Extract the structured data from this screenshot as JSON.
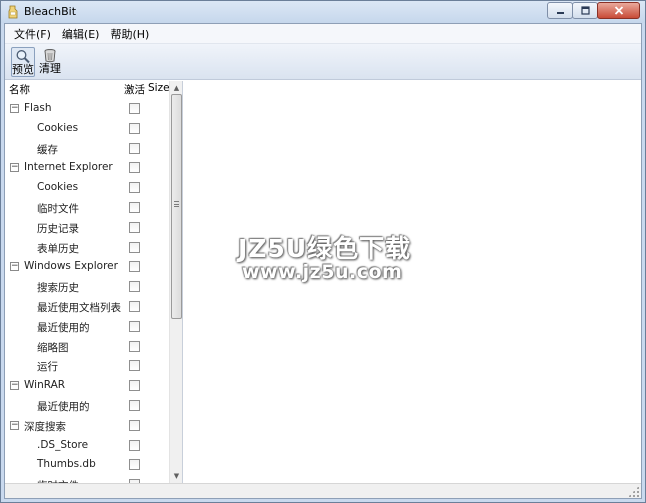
{
  "window": {
    "title": "BleachBit"
  },
  "menu": [
    {
      "label": "文件(F)"
    },
    {
      "label": "编辑(E)"
    },
    {
      "label": "帮助(H)"
    }
  ],
  "toolbar": {
    "preview_label": "预览",
    "clean_label": "清理"
  },
  "tree": {
    "columns": {
      "name": "名称",
      "active": "激活",
      "size": "Size"
    },
    "rows": [
      {
        "label": "Flash",
        "level": 0,
        "expander": "−"
      },
      {
        "label": "Cookies",
        "level": 1
      },
      {
        "label": "缓存",
        "level": 1
      },
      {
        "label": "Internet Explorer",
        "level": 0,
        "expander": "−"
      },
      {
        "label": "Cookies",
        "level": 1
      },
      {
        "label": "临时文件",
        "level": 1
      },
      {
        "label": "历史记录",
        "level": 1
      },
      {
        "label": "表单历史",
        "level": 1
      },
      {
        "label": "Windows Explorer",
        "level": 0,
        "expander": "−"
      },
      {
        "label": "搜索历史",
        "level": 1
      },
      {
        "label": "最近使用文档列表",
        "level": 1
      },
      {
        "label": "最近使用的",
        "level": 1
      },
      {
        "label": "缩略图",
        "level": 1
      },
      {
        "label": "运行",
        "level": 1
      },
      {
        "label": "WinRAR",
        "level": 0,
        "expander": "−"
      },
      {
        "label": "最近使用的",
        "level": 1
      },
      {
        "label": "深度搜索",
        "level": 0,
        "expander": "−"
      },
      {
        "label": ".DS_Store",
        "level": 1
      },
      {
        "label": "Thumbs.db",
        "level": 1
      },
      {
        "label": "临时文件",
        "level": 1
      }
    ]
  },
  "watermark": {
    "title": "JZ5U绿色下载",
    "url": "www.jz5u.com"
  }
}
